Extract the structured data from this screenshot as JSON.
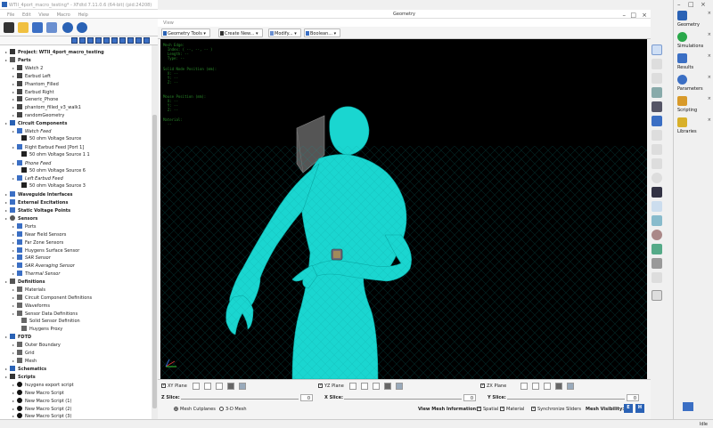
{
  "window": {
    "title": "WTII_4port_macro_testing* - XFdtd 7.11.0.6 (64-bit) (pid:24208)"
  },
  "menu": [
    "File",
    "Edit",
    "View",
    "Macro",
    "Help"
  ],
  "tree": [
    {
      "label": "Project: WTII_4port_macro_testing",
      "style": "bold",
      "indent": 0,
      "icon": "project-icon"
    },
    {
      "label": "Parts",
      "style": "bold",
      "indent": 0,
      "icon": "parts-icon"
    },
    {
      "label": "Watch 2",
      "style": "",
      "indent": 1,
      "icon": "part-icon"
    },
    {
      "label": "Earbud Left",
      "style": "",
      "indent": 1,
      "icon": "part-icon"
    },
    {
      "label": "Phantom_Filled",
      "style": "",
      "indent": 1,
      "icon": "part-icon"
    },
    {
      "label": "Earbud Right",
      "style": "",
      "indent": 1,
      "icon": "part-icon"
    },
    {
      "label": "Generic_Phone",
      "style": "",
      "indent": 1,
      "icon": "part-icon"
    },
    {
      "label": "phantom_filled_v3_walk1",
      "style": "",
      "indent": 1,
      "icon": "part-icon"
    },
    {
      "label": "randomGeometry",
      "style": "",
      "indent": 1,
      "icon": "part-icon"
    },
    {
      "label": "Circuit Components",
      "style": "bold",
      "indent": 0,
      "icon": "circuit-icon"
    },
    {
      "label": "Watch Feed",
      "style": "ital",
      "indent": 1,
      "icon": "feed-icon"
    },
    {
      "label": "50 ohm Voltage Source",
      "style": "",
      "indent": 2,
      "icon": "source-icon"
    },
    {
      "label": "Right Earbud Feed [Port 1]",
      "style": "",
      "indent": 1,
      "icon": "feed-icon"
    },
    {
      "label": "50 ohm Voltage Source 1 1",
      "style": "",
      "indent": 2,
      "icon": "source-icon"
    },
    {
      "label": "Phone Feed",
      "style": "ital",
      "indent": 1,
      "icon": "feed-icon"
    },
    {
      "label": "50 ohm Voltage Source 6",
      "style": "",
      "indent": 2,
      "icon": "source-icon"
    },
    {
      "label": "Left Earbud Feed",
      "style": "ital",
      "indent": 1,
      "icon": "feed-icon"
    },
    {
      "label": "50 ohm Voltage Source 3",
      "style": "",
      "indent": 2,
      "icon": "source-icon"
    },
    {
      "label": "Waveguide Interfaces",
      "style": "bold",
      "indent": 0,
      "icon": "waveguide-icon"
    },
    {
      "label": "External Excitations",
      "style": "bold",
      "indent": 0,
      "icon": "excitation-icon"
    },
    {
      "label": "Static Voltage Points",
      "style": "bold",
      "indent": 0,
      "icon": "voltage-icon"
    },
    {
      "label": "Sensors",
      "style": "bold",
      "indent": 0,
      "icon": "sensors-icon"
    },
    {
      "label": "Ports",
      "style": "",
      "indent": 1,
      "icon": "sensor-icon"
    },
    {
      "label": "Near Field Sensors",
      "style": "",
      "indent": 1,
      "icon": "sensor-icon"
    },
    {
      "label": "Far Zone Sensors",
      "style": "",
      "indent": 1,
      "icon": "sensor-icon"
    },
    {
      "label": "Huygens Surface Sensor",
      "style": "",
      "indent": 1,
      "icon": "sensor-icon"
    },
    {
      "label": "SAR Sensor",
      "style": "ital",
      "indent": 1,
      "icon": "sensor-icon"
    },
    {
      "label": "SAR Averaging Sensor",
      "style": "ital",
      "indent": 1,
      "icon": "sensor-icon"
    },
    {
      "label": "Thermal Sensor",
      "style": "ital",
      "indent": 1,
      "icon": "sensor-icon"
    },
    {
      "label": "Definitions",
      "style": "bold",
      "indent": 0,
      "icon": "definitions-icon"
    },
    {
      "label": "Materials",
      "style": "",
      "indent": 1,
      "icon": "def-icon"
    },
    {
      "label": "Circuit Component Definitions",
      "style": "",
      "indent": 1,
      "icon": "def-icon"
    },
    {
      "label": "Waveforms",
      "style": "",
      "indent": 1,
      "icon": "def-icon"
    },
    {
      "label": "Sensor Data Definitions",
      "style": "",
      "indent": 1,
      "icon": "def-icon"
    },
    {
      "label": "Solid Sensor Definition",
      "style": "",
      "indent": 2,
      "icon": "def-icon"
    },
    {
      "label": "Huygens Proxy",
      "style": "",
      "indent": 2,
      "icon": "def-icon"
    },
    {
      "label": "FDTD",
      "style": "bold",
      "indent": 0,
      "icon": "fdtd-icon"
    },
    {
      "label": "Outer Boundary",
      "style": "",
      "indent": 1,
      "icon": "def-icon"
    },
    {
      "label": "Grid",
      "style": "",
      "indent": 1,
      "icon": "def-icon"
    },
    {
      "label": "Mesh",
      "style": "",
      "indent": 1,
      "icon": "def-icon"
    },
    {
      "label": "Schematics",
      "style": "bold",
      "indent": 0,
      "icon": "schematic-icon"
    },
    {
      "label": "Scripts",
      "style": "bold",
      "indent": 0,
      "icon": "scripts-icon"
    },
    {
      "label": "huygens export script",
      "style": "",
      "indent": 1,
      "icon": "script-icon"
    },
    {
      "label": "New Macro Script",
      "style": "",
      "indent": 1,
      "icon": "script-icon"
    },
    {
      "label": "New Macro Script (1)",
      "style": "",
      "indent": 1,
      "icon": "script-icon"
    },
    {
      "label": "New Macro Script (2)",
      "style": "",
      "indent": 1,
      "icon": "script-icon"
    },
    {
      "label": "New Macro Script (3)",
      "style": "",
      "indent": 1,
      "icon": "script-icon"
    }
  ],
  "geometry": {
    "title": "Geometry",
    "view_menu": "View",
    "tools": [
      "Geometry Tools",
      "Create New...",
      "Modify...",
      "Boolean..."
    ],
    "overlay": {
      "mesh_edge": "Mesh Edge:\n  Index: ( --, --, -- )\n  Length: --\n  Type: --",
      "solid_node": "Solid Node Position (mm):\n  X: --\n  Y: --\n  Z: --",
      "mouse": "Mouse Position (mm):\n  X: --\n  Y: --\n  Z: --",
      "material": "Material:\n  --"
    }
  },
  "planes": [
    {
      "label": "XY Plane",
      "checked": true,
      "slice_label": "Z Slice:",
      "value": "0"
    },
    {
      "label": "YZ Plane",
      "checked": true,
      "slice_label": "X Slice:",
      "value": "0"
    },
    {
      "label": "ZX Plane",
      "checked": true,
      "slice_label": "Y Slice:",
      "value": "0"
    }
  ],
  "mesh_options": {
    "mesh_cutplanes": "Mesh Cutplanes",
    "mesh_3d": "3-D Mesh",
    "view_info_label": "View Mesh Information:",
    "spatial": "Spatial",
    "material": "Material",
    "sync": "Synchronize Sliders",
    "visibility_label": "Mesh Visibility:",
    "visibility_e": "E",
    "visibility_h": "H"
  },
  "right_tabs": [
    {
      "label": "Geometry",
      "icon": "geometry-icon",
      "color": "#2a62b5"
    },
    {
      "label": "Simulations",
      "icon": "simulations-icon",
      "color": "#2aa84a"
    },
    {
      "label": "Results",
      "icon": "results-icon",
      "color": "#3b6fc4"
    },
    {
      "label": "Parameters",
      "icon": "parameters-icon",
      "color": "#3b6fc4"
    },
    {
      "label": "Scripting",
      "icon": "scripting-icon",
      "color": "#d89a2a"
    },
    {
      "label": "Libraries",
      "icon": "libraries-icon",
      "color": "#d8b02a"
    }
  ],
  "status": {
    "text": "Idle"
  },
  "colors": {
    "mesh": "#1ad6d0",
    "mesh_dark": "#0aa8a4",
    "background": "#000000"
  }
}
